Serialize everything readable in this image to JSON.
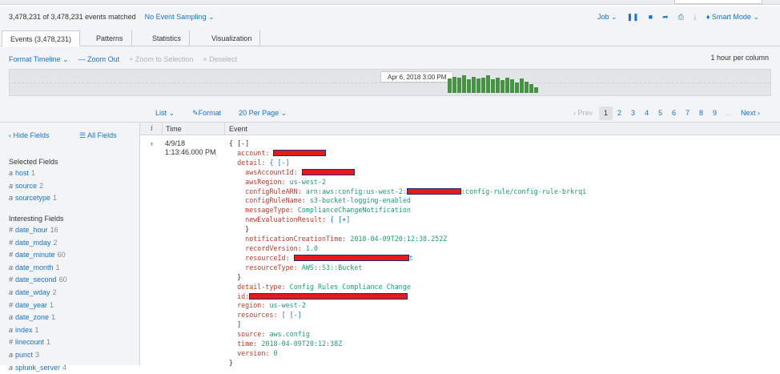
{
  "summary": {
    "matched": "3,478,231 of 3,478,231 events matched",
    "sampling": "No Event Sampling"
  },
  "job_controls": {
    "job": "Job",
    "mode": "Smart Mode"
  },
  "tabs": [
    "Events (3,478,231)",
    "Patterns",
    "Statistics",
    "Visualization"
  ],
  "timeline": {
    "format": "Format Timeline",
    "zoom_out": "— Zoom Out",
    "zoom_selection": "+ Zoom to Selection",
    "deselect": "× Deselect",
    "scale": "1 hour per column",
    "tooltip": "Apr 6, 2018 3:00 PM",
    "bars": [
      0.75,
      0.85,
      0.8,
      0.9,
      0.7,
      0.85,
      0.75,
      0.8,
      0.9,
      0.7,
      0.8,
      0.65,
      0.8,
      0.7,
      0.55,
      0.75,
      0.6,
      0.45,
      0.3
    ]
  },
  "listbar": {
    "list": "List",
    "format": "Format",
    "per_page": "20 Per Page",
    "prev": "‹ Prev",
    "pages": [
      "1",
      "2",
      "3",
      "4",
      "5",
      "6",
      "7",
      "8",
      "9"
    ],
    "current_page": "1",
    "ellipsis": "...",
    "next": "Next ›"
  },
  "sidebar": {
    "hide_fields": "‹ Hide Fields",
    "all_fields": "All Fields",
    "selected_heading": "Selected Fields",
    "selected": [
      {
        "type": "a",
        "name": "host",
        "count": "1"
      },
      {
        "type": "a",
        "name": "source",
        "count": "2"
      },
      {
        "type": "a",
        "name": "sourcetype",
        "count": "1"
      }
    ],
    "interesting_heading": "Interesting Fields",
    "interesting": [
      {
        "type": "#",
        "name": "date_hour",
        "count": "16"
      },
      {
        "type": "#",
        "name": "date_mday",
        "count": "2"
      },
      {
        "type": "#",
        "name": "date_minute",
        "count": "60"
      },
      {
        "type": "a",
        "name": "date_month",
        "count": "1"
      },
      {
        "type": "#",
        "name": "date_second",
        "count": "60"
      },
      {
        "type": "a",
        "name": "date_wday",
        "count": "2"
      },
      {
        "type": "#",
        "name": "date_year",
        "count": "1"
      },
      {
        "type": "a",
        "name": "date_zone",
        "count": "1"
      },
      {
        "type": "a",
        "name": "index",
        "count": "1"
      },
      {
        "type": "#",
        "name": "linecount",
        "count": "1"
      },
      {
        "type": "a",
        "name": "punct",
        "count": "3"
      },
      {
        "type": "a",
        "name": "splunk_server",
        "count": "4"
      }
    ]
  },
  "results": {
    "col_i": "i",
    "col_time": "Time",
    "col_event": "Event",
    "row": {
      "date": "4/9/18",
      "time": "1:13:46.000 PM",
      "event": {
        "open": "{ [-]",
        "account_key": "account:",
        "detail_key": "detail:",
        "detail_open": "{ [-]",
        "awsAccountId_key": "awsAccountId:",
        "awsRegion_key": "awsRegion:",
        "awsRegion_val": "us-west-2",
        "configRuleARN_key": "configRuleARN:",
        "configRuleARN_val1": "arn:aws:config:us-west-2:",
        "configRuleARN_val2": ":config-rule/config-rule-brkrqi",
        "configRuleName_key": "configRuleName:",
        "configRuleName_val": "s3-bucket-logging-enabled",
        "messageType_key": "messageType:",
        "messageType_val": "ComplianceChangeNotification",
        "newEvaluationResult_key": "newEvaluationResult:",
        "newEvaluationResult_open": "{ [+]",
        "close_brace": "}",
        "notificationCreationTime_key": "notificationCreationTime:",
        "notificationCreationTime_val": "2018-04-09T20:12:38.252Z",
        "recordVersion_key": "recordVersion:",
        "recordVersion_val": "1.0",
        "resourceId_key": "resourceId:",
        "resourceId_tail": "t",
        "resourceType_key": "resourceType:",
        "resourceType_val": "AWS::S3::Bucket",
        "detailtype_key": "detail-type:",
        "detailtype_val": "Config Rules Compliance Change",
        "id_key": "id:",
        "region_key": "region:",
        "region_val": "us-west-2",
        "resources_key": "resources:",
        "resources_open": "[ [-]",
        "resources_close": "]",
        "source_key": "source:",
        "source_val": "aws.config",
        "time_key": "time:",
        "time_val": "2018-04-09T20:12:38Z",
        "version_key": "version:",
        "version_val": "0",
        "end_brace": "}"
      }
    }
  }
}
